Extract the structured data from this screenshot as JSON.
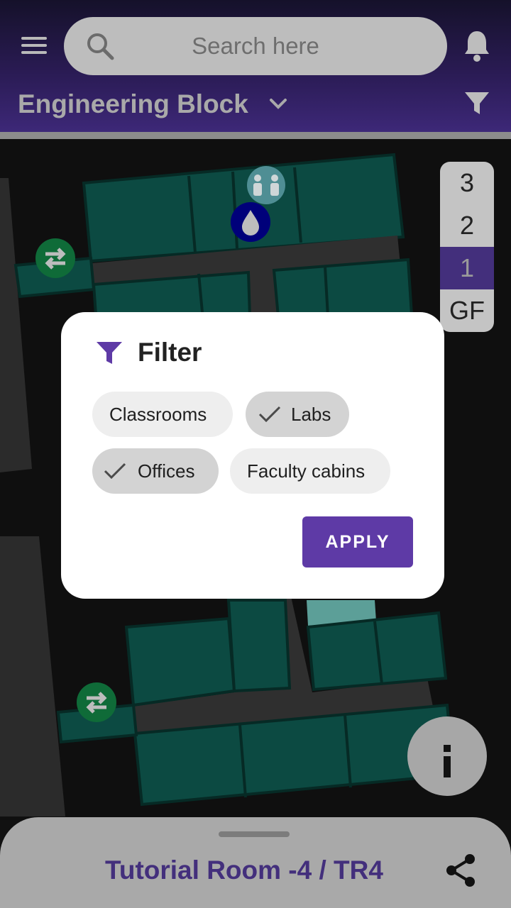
{
  "header": {
    "search_placeholder": "Search here",
    "building_name": "Engineering Block"
  },
  "floors": [
    "3",
    "2",
    "1",
    "GF"
  ],
  "selected_floor": "1",
  "filter_dialog": {
    "title": "Filter",
    "chips": [
      {
        "label": "Classrooms",
        "selected": false
      },
      {
        "label": "Labs",
        "selected": true
      },
      {
        "label": "Offices",
        "selected": true
      },
      {
        "label": "Faculty cabins",
        "selected": false
      }
    ],
    "apply_label": "APPLY"
  },
  "bottom_sheet": {
    "room_name": "Tutorial Room -4 / TR4"
  },
  "colors": {
    "accent": "#5e3aa6",
    "room_fill": "#0d4d45",
    "header_gradient_end": "#3d2878"
  },
  "icons": [
    "menu-icon",
    "search-icon",
    "bell-icon",
    "chevron-down-icon",
    "filter-icon",
    "washroom-icon",
    "drinking-water-icon",
    "stairs-icon",
    "check-icon",
    "info-icon",
    "share-icon"
  ]
}
